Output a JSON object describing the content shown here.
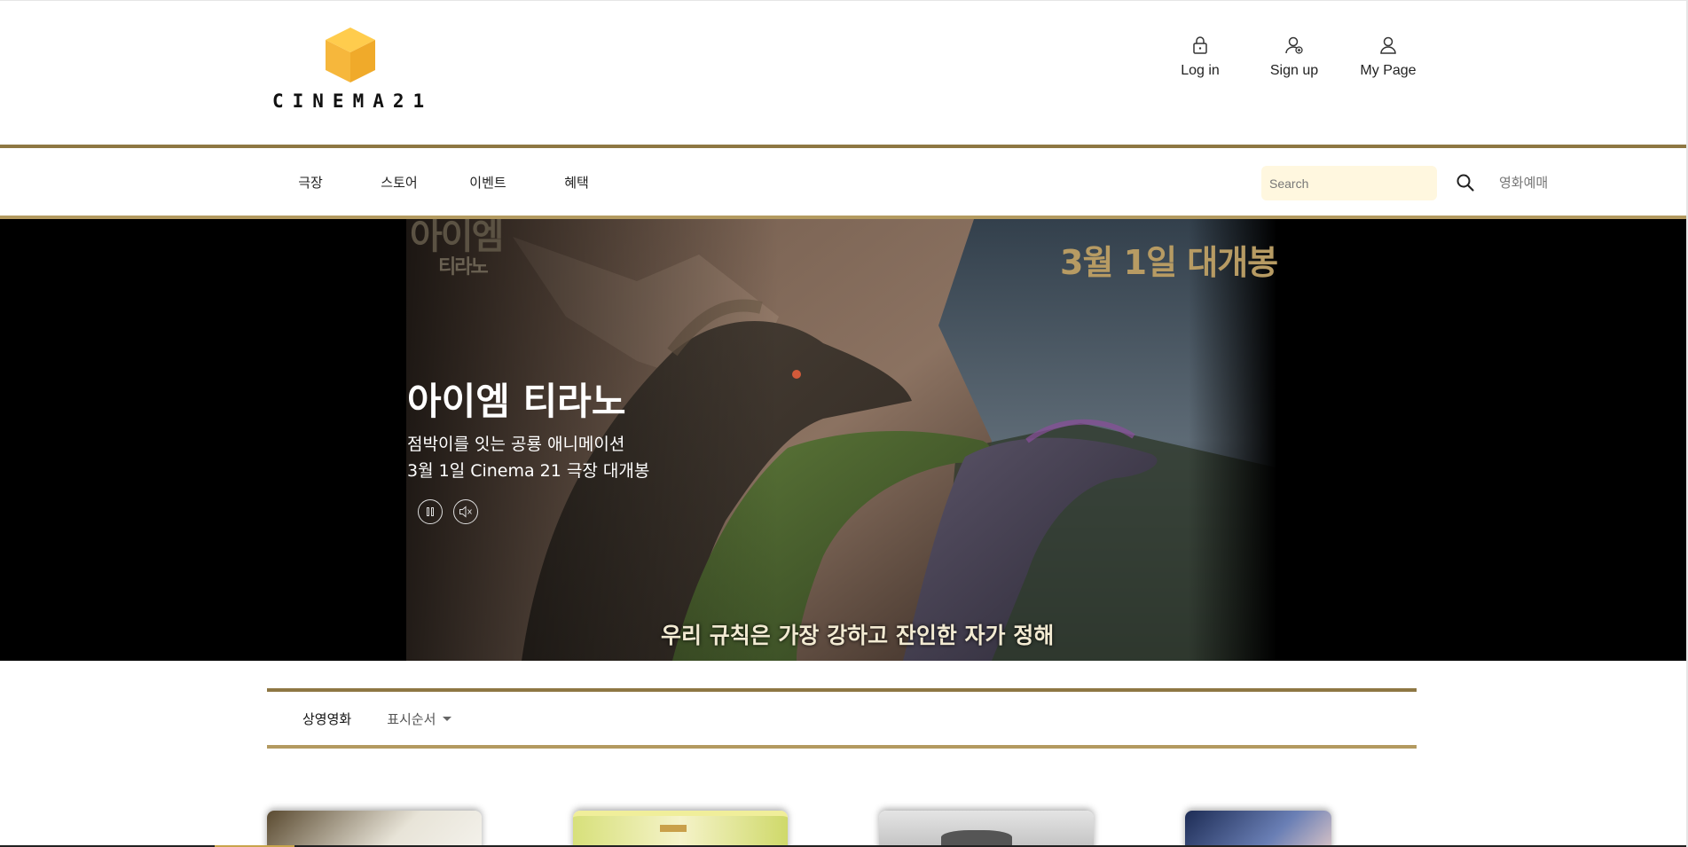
{
  "brand": {
    "name": "CINEMA21",
    "accent": "#8e7743",
    "logo_color": "#f6b73c"
  },
  "header": {
    "user_links": [
      {
        "label": "Log in",
        "icon": "lock-icon"
      },
      {
        "label": "Sign up",
        "icon": "user-add-icon"
      },
      {
        "label": "My Page",
        "icon": "user-icon"
      }
    ]
  },
  "nav": {
    "items": [
      "극장",
      "스토어",
      "이벤트",
      "혜택"
    ],
    "search_placeholder": "Search",
    "search_icon": "search-icon",
    "booking_label": "영화예매"
  },
  "hero": {
    "title": "아이엠 티라노",
    "desc_line1": "점박이를 잇는 공룡 애니메이션",
    "desc_line2": "3월 1일 Cinema 21 극장 대개봉",
    "pause_icon": "pause-icon",
    "mute_icon": "mute-icon",
    "image_logo": "아이엠",
    "image_logo_sub": "티라노",
    "image_tagline": "3월 1일 대개봉",
    "image_subtitle": "우리 규칙은 가장 강하고 잔인한 자가 정해"
  },
  "movie_list": {
    "tab_label": "상영영화",
    "sort_label": "표시순서"
  }
}
